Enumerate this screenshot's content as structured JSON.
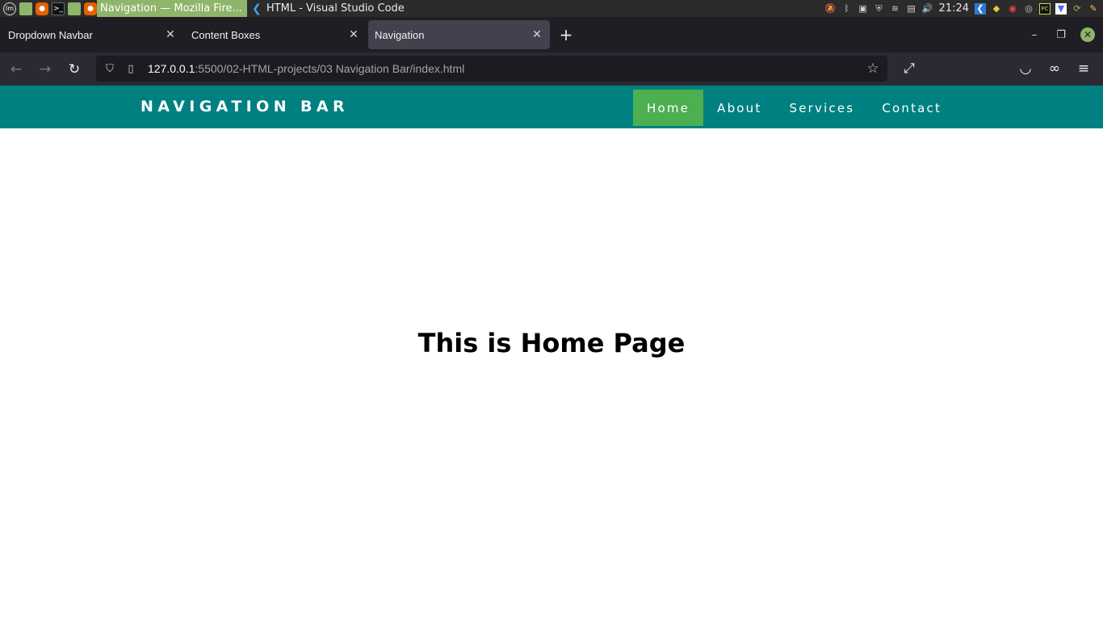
{
  "os_panel": {
    "taskbar": [
      {
        "label": "Navigation — Mozilla Fire...",
        "active": true
      },
      {
        "label": "HTML - Visual Studio Code",
        "active": false
      }
    ],
    "clock": "21:24"
  },
  "browser": {
    "tabs": [
      {
        "title": "Dropdown Navbar"
      },
      {
        "title": "Content Boxes"
      },
      {
        "title": "Navigation"
      }
    ],
    "url_host": "127.0.0.1",
    "url_path": ":5500/02-HTML-projects/03 Navigation Bar/index.html"
  },
  "site": {
    "brand": "NAVIGATION BAR",
    "menu": [
      {
        "label": "Home",
        "active": true
      },
      {
        "label": "About",
        "active": false
      },
      {
        "label": "Services",
        "active": false
      },
      {
        "label": "Contact",
        "active": false
      }
    ],
    "heading": "This is Home Page"
  },
  "colors": {
    "nav_bg": "#008080",
    "active_menu_bg": "#4caf50",
    "os_active_task": "#8fb56a"
  }
}
